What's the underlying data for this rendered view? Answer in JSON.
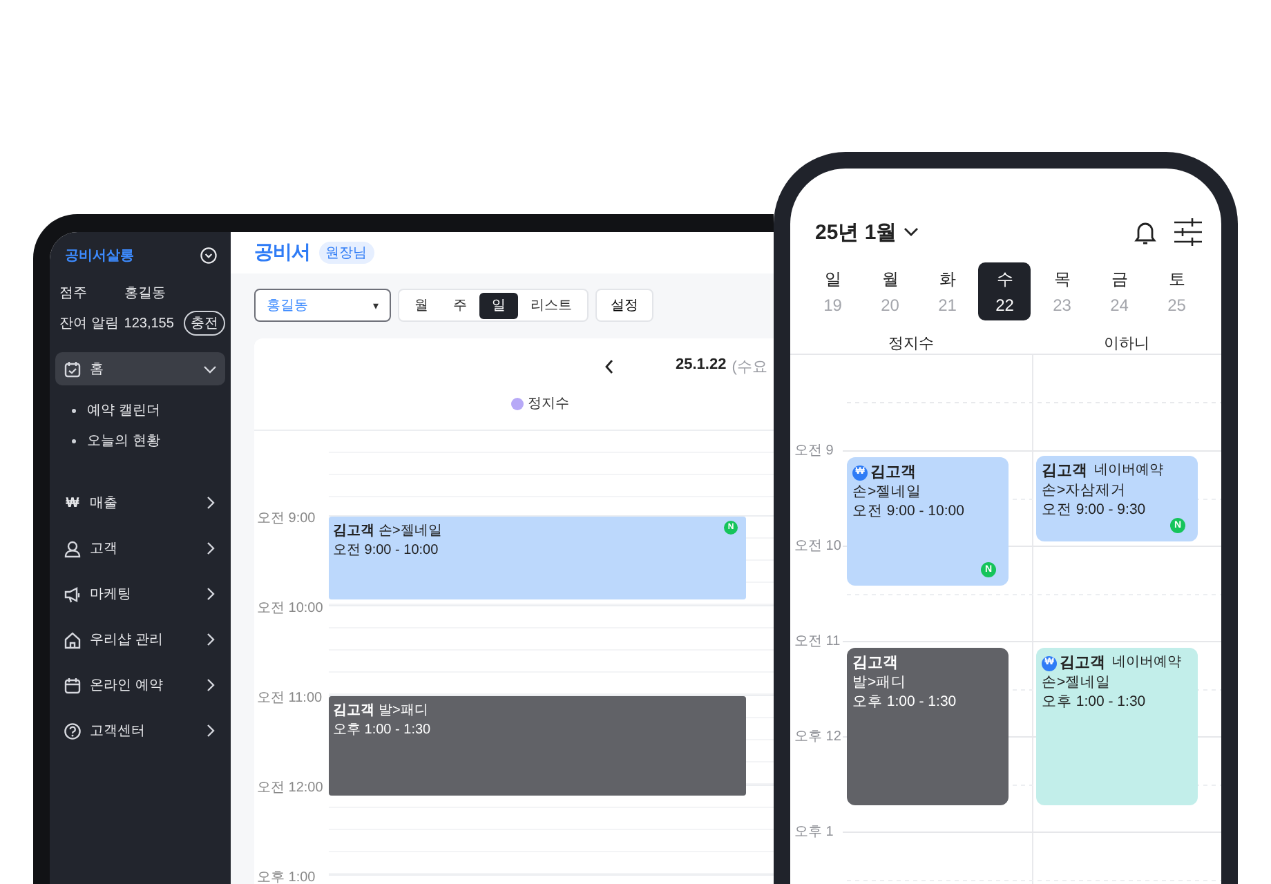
{
  "tablet": {
    "sidebar": {
      "shop_name": "공비서살롱",
      "owner_label": "점주",
      "owner_name": "홍길동",
      "alerts_label": "잔여 알림",
      "alerts_count": "123,155",
      "charge_button": "충전",
      "menu": [
        {
          "label": "홈",
          "selected": true,
          "expanded": true,
          "children": [
            {
              "label": "예약 캘린더"
            },
            {
              "label": "오늘의 현황"
            }
          ]
        },
        {
          "label": "매출",
          "glyph": "₩",
          "selected": false,
          "expanded": false
        },
        {
          "label": "고객",
          "selected": false,
          "expanded": false
        },
        {
          "label": "마케팅",
          "selected": false,
          "expanded": false
        },
        {
          "label": "우리샵 관리",
          "selected": false,
          "expanded": false
        },
        {
          "label": "온라인 예약",
          "selected": false,
          "expanded": false
        },
        {
          "label": "고객센터",
          "selected": false,
          "expanded": false
        }
      ]
    },
    "header": {
      "logo": "공비서",
      "role_badge": "원장님"
    },
    "toolbar": {
      "staff_select": "홍길동",
      "select_caret": "▾",
      "views": [
        {
          "label": "월",
          "selected": false
        },
        {
          "label": "주",
          "selected": false
        },
        {
          "label": "일",
          "selected": true
        },
        {
          "label": "리스트",
          "selected": false
        }
      ],
      "settings_button": "설정"
    },
    "calendar": {
      "date": "25.1.22",
      "weekday": "(수요",
      "legend": [
        {
          "name": "정지수",
          "color": "#b7a9f7"
        }
      ],
      "time_labels": [
        "오전 9:00",
        "오전 10:00",
        "오전 11:00",
        "오전 12:00",
        "오후 1:00"
      ],
      "events": [
        {
          "customer": "김고객",
          "service": "손>젤네일",
          "time": "오전 9:00 - 10:00",
          "color": "#bcd8fc",
          "badge": "N"
        },
        {
          "customer": "김고객",
          "service": "발>패디",
          "time": "오후 1:00 - 1:30",
          "color": "#616267"
        }
      ]
    }
  },
  "phone": {
    "month": "25년 1월",
    "days": [
      {
        "weekday": "일",
        "date": "19",
        "selected": false
      },
      {
        "weekday": "월",
        "date": "20",
        "selected": false
      },
      {
        "weekday": "화",
        "date": "21",
        "selected": false
      },
      {
        "weekday": "수",
        "date": "22",
        "selected": true
      },
      {
        "weekday": "목",
        "date": "23",
        "selected": false
      },
      {
        "weekday": "금",
        "date": "24",
        "selected": false
      },
      {
        "weekday": "토",
        "date": "25",
        "selected": false
      }
    ],
    "staff": [
      "정지수",
      "이하니"
    ],
    "time_labels": [
      "오전 9",
      "오전 10",
      "오전 11",
      "오후 12",
      "오후 1"
    ],
    "columns": [
      {
        "events": [
          {
            "prefix": "₩",
            "customer": "김고객",
            "service": "손>젤네일",
            "time": "오전 9:00 - 10:00",
            "color": "#bcd8fc",
            "badge": "N"
          },
          {
            "customer": "김고객",
            "service": "발>패디",
            "time": "오후 1:00 - 1:30",
            "color": "#616267"
          }
        ]
      },
      {
        "events": [
          {
            "customer": "김고객",
            "source": "네이버예약",
            "service": "손>자삼제거",
            "time": "오전 9:00 - 9:30",
            "color": "#bcd8fc",
            "badge": "N"
          },
          {
            "prefix": "₩",
            "customer": "김고객",
            "source": "네이버예약",
            "service": "손>젤네일",
            "time": "오후 1:00 - 1:30",
            "color": "#c2eeea"
          }
        ]
      }
    ]
  }
}
